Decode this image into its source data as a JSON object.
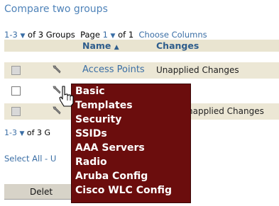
{
  "compare_link": "Compare two groups",
  "pager_top": {
    "range": "1-3",
    "total": "of 3 Groups",
    "page_label": "Page",
    "page": "1",
    "page_of": "of 1",
    "choose_columns": "Choose Columns"
  },
  "table": {
    "headers": {
      "name": "Name",
      "sort_indicator": "▲",
      "changes": "Changes"
    },
    "rows": [
      {
        "name": "Access Points",
        "changes": "Unapplied Changes"
      },
      {
        "name": "",
        "changes": ""
      },
      {
        "name": "",
        "changes": "napplied Changes"
      }
    ]
  },
  "pager_bottom": {
    "range": "1-3",
    "total": "of 3 G"
  },
  "select_all": "Select All - U",
  "delete_button": "Delet",
  "context_menu": {
    "items": [
      "Basic",
      "Templates",
      "Security",
      "SSIDs",
      "AAA Servers",
      "Radio",
      "Aruba Config",
      "Cisco WLC Config"
    ]
  },
  "icons": {
    "dropdown": "triangle-down-icon",
    "row_action": "wrench-icon",
    "pointer": "hand-cursor-icon"
  },
  "colors": {
    "link": "#3a6ea5",
    "header_bg": "#e9e4d0",
    "menu_bg": "#6b0d0d",
    "menu_text": "#ffffff"
  }
}
